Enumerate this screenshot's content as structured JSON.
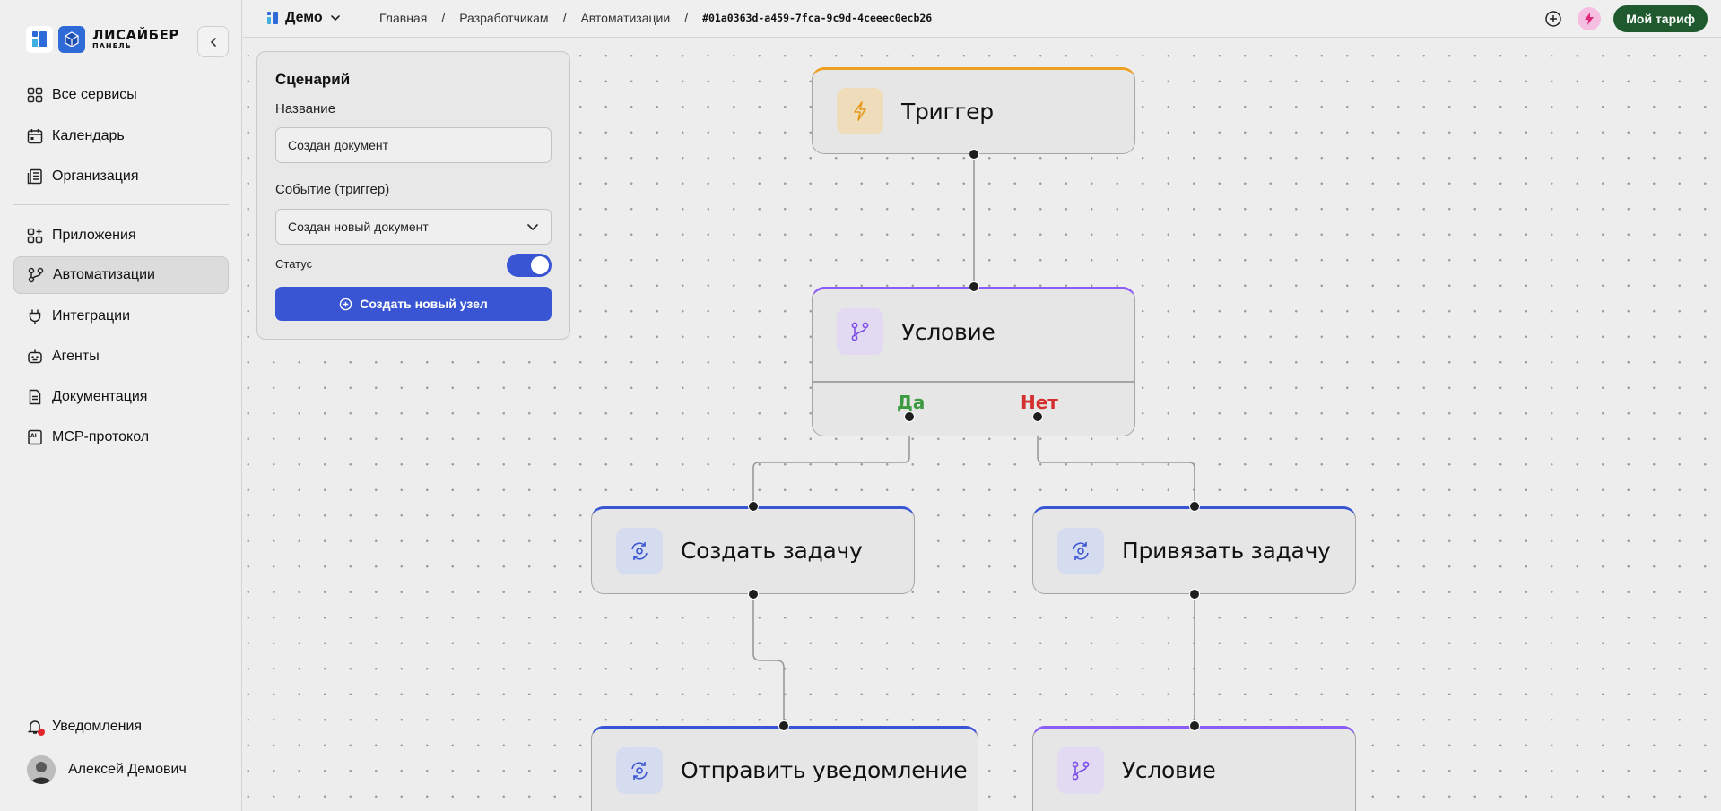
{
  "sidebar": {
    "logo_title": "ЛИСАЙБЕР",
    "logo_sub": "ПАНЕЛЬ",
    "items": [
      {
        "label": "Все сервисы",
        "icon": "grid-icon"
      },
      {
        "label": "Календарь",
        "icon": "calendar-icon"
      },
      {
        "label": "Организация",
        "icon": "building-icon"
      },
      {
        "label": "Приложения",
        "icon": "apps-icon"
      },
      {
        "label": "Автоматизации",
        "icon": "workflow-icon",
        "active": true
      },
      {
        "label": "Интеграции",
        "icon": "plug-icon"
      },
      {
        "label": "Агенты",
        "icon": "robot-icon"
      },
      {
        "label": "Документация",
        "icon": "document-icon"
      },
      {
        "label": "MCP-протокол",
        "icon": "ai-doc-icon"
      }
    ],
    "notifications_label": "Уведомления",
    "user_name": "Алексей Демович"
  },
  "topbar": {
    "workspace": "Демо",
    "breadcrumbs": [
      "Главная",
      "Разработчикам",
      "Автоматизации"
    ],
    "breadcrumb_id": "#01a0363d-a459-7fca-9c9d-4ceeec0ecb26",
    "plan_label": "Мой тариф"
  },
  "panel": {
    "title": "Сценарий",
    "name_label": "Название",
    "name_value": "Создан документ",
    "event_label": "Событие (триггер)",
    "event_value": "Создан новый документ",
    "status_label": "Статус",
    "status_on": true,
    "create_label": "Создать новый узел"
  },
  "nodes": {
    "trigger": {
      "title": "Триггер",
      "accent": "#f0a020"
    },
    "condition1": {
      "title": "Условие",
      "accent": "#8b5cf6",
      "yes": "Да",
      "no": "Нет"
    },
    "create_task": {
      "title": "Создать задачу",
      "accent": "#3a55d4"
    },
    "link_task": {
      "title": "Привязать задачу",
      "accent": "#3a55d4"
    },
    "notify": {
      "title": "Отправить уведомление",
      "accent": "#3a55d4"
    },
    "condition2": {
      "title": "Условие",
      "accent": "#8b5cf6"
    }
  },
  "colors": {
    "yes": "#3d9a40",
    "no": "#d32f2f",
    "primary": "#3a55d4",
    "plan": "#1f5a2e"
  }
}
